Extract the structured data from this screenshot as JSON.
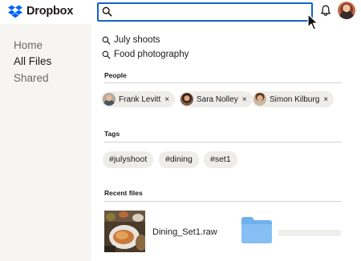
{
  "app": {
    "brand": "Dropbox"
  },
  "search": {
    "value": "",
    "placeholder": ""
  },
  "sidebar": {
    "items": [
      {
        "label": "Home",
        "active": false
      },
      {
        "label": "All Files",
        "active": true
      },
      {
        "label": "Shared",
        "active": false
      }
    ]
  },
  "suggestions": [
    {
      "label": "July shoots",
      "icon": "search-icon"
    },
    {
      "label": "Food photography",
      "icon": "search-icon"
    }
  ],
  "people": {
    "title": "People",
    "items": [
      {
        "name": "Frank Levitt",
        "remove": "×"
      },
      {
        "name": "Sara Nolley",
        "remove": "×"
      },
      {
        "name": "Simon Kilburg",
        "remove": "×"
      }
    ]
  },
  "tags": {
    "title": "Tags",
    "items": [
      "#julyshoot",
      "#dining",
      "#set1"
    ]
  },
  "recent": {
    "title": "Recent files",
    "files": [
      {
        "name": "Dining_Set1.raw",
        "type": "image"
      }
    ]
  },
  "colors": {
    "accent": "#1564c6",
    "brand": "#0061fe",
    "sidebar_bg": "#f7f5f2",
    "chip_bg": "#efedea",
    "folder": "#7cb7f2"
  }
}
